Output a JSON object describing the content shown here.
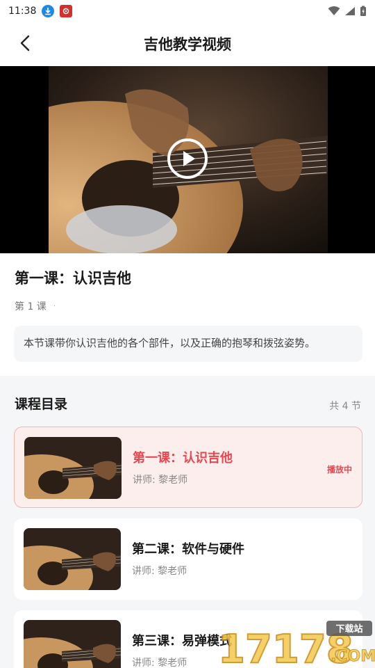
{
  "status_bar": {
    "time": "11:38"
  },
  "header": {
    "title": "吉他教学视频"
  },
  "video": {
    "state": "paused"
  },
  "lesson": {
    "title": "第一课：认识吉他",
    "number": "第 1 课",
    "separator": "·",
    "description": "本节课带你认识吉他的各个部件，以及正确的抱琴和拨弦姿势。"
  },
  "catalog": {
    "title": "课程目录",
    "count": "共 4 节",
    "items": [
      {
        "name": "第一课：认识吉他",
        "teacher": "讲师: 黎老师",
        "tag": "播放中"
      },
      {
        "name": "第二课：软件与硬件",
        "teacher": "讲师: 黎老师"
      },
      {
        "name": "第三课：易弹模式",
        "teacher": "讲师: 黎老师"
      }
    ]
  },
  "watermark": {
    "text": "17178",
    "tag": "下载站",
    "suffix": ".COM"
  },
  "colors": {
    "accent": "#e8474e",
    "active_bg": "#fdeeee",
    "page_bg": "#f5f6f8"
  }
}
